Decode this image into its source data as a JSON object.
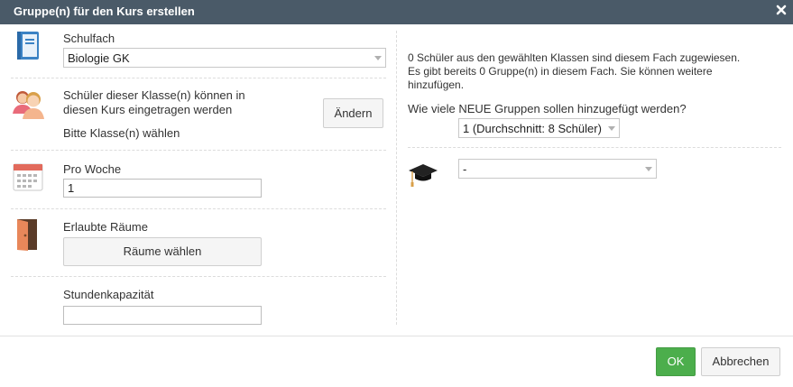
{
  "dialog": {
    "title": "Gruppe(n) für den Kurs erstellen"
  },
  "left": {
    "subject": {
      "label": "Schulfach",
      "value": "Biologie GK"
    },
    "students": {
      "label_line1": "Schüler dieser Klasse(n) können in",
      "label_line2": "diesen Kurs eingetragen werden",
      "status": "Bitte Klasse(n) wählen",
      "change_button": "Ändern"
    },
    "per_week": {
      "label": "Pro Woche",
      "value": "1"
    },
    "rooms": {
      "label": "Erlaubte Räume",
      "button": "Räume wählen"
    },
    "capacity": {
      "label": "Stundenkapazität",
      "value": ""
    }
  },
  "right": {
    "info_line1": "0 Schüler aus den gewählten Klassen sind diesem Fach zugewiesen.",
    "info_line2": "Es gibt bereits 0 Gruppe(n) in diesem Fach. Sie können weitere",
    "info_line3": "hinzufügen.",
    "question": "Wie viele NEUE Gruppen sollen hinzugefügt werden?",
    "groups_select": "1 (Durchschnitt: 8 Schüler)",
    "teacher_select": "-"
  },
  "footer": {
    "ok_button": "OK",
    "cancel_button": "Abbrechen"
  },
  "colors": {
    "titlebar": "#4a5a68",
    "ok": "#4cae4c"
  }
}
